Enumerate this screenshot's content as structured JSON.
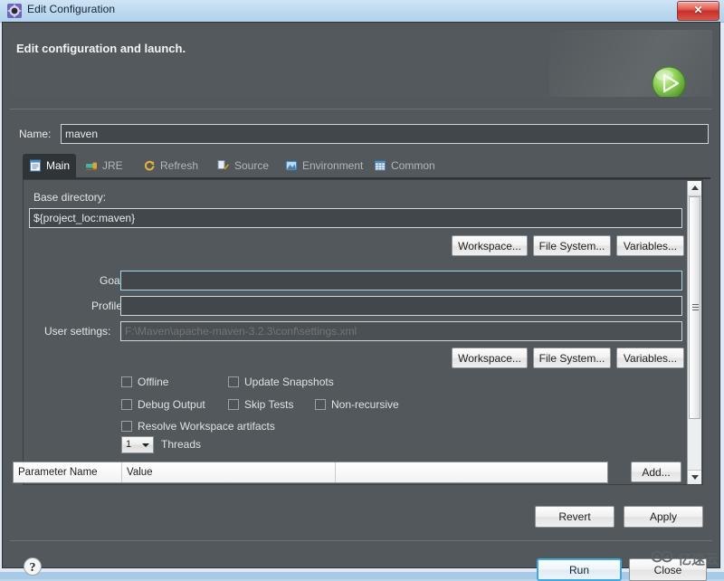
{
  "window": {
    "title": "Edit Configuration",
    "title_icon": "configuration-gear-icon",
    "close_glyph": "✕"
  },
  "header": {
    "title": "Edit configuration and launch.",
    "run_icon": "green-run-play-icon"
  },
  "name_field": {
    "label": "Name:",
    "value": "maven"
  },
  "tabs": [
    {
      "label": "Main",
      "icon": "document-icon",
      "active": true
    },
    {
      "label": "JRE",
      "icon": "jre-icon",
      "active": false
    },
    {
      "label": "Refresh",
      "icon": "refresh-icon",
      "active": false
    },
    {
      "label": "Source",
      "icon": "source-pencil-icon",
      "active": false
    },
    {
      "label": "Environment",
      "icon": "environment-icon",
      "active": false
    },
    {
      "label": "Common",
      "icon": "common-table-icon",
      "active": false
    }
  ],
  "main": {
    "base_directory": {
      "label": "Base directory:",
      "value": "${project_loc:maven}"
    },
    "dir_buttons": [
      {
        "label": "Workspace..."
      },
      {
        "label": "File System..."
      },
      {
        "label": "Variables..."
      }
    ],
    "goals": {
      "label": "Goals:",
      "value": ""
    },
    "profiles": {
      "label": "Profiles:",
      "value": ""
    },
    "user_settings": {
      "label": "User settings:",
      "value": "",
      "placeholder": "F:\\Maven\\apache-maven-3.2.3\\conf\\settings.xml"
    },
    "settings_buttons": [
      {
        "label": "Workspace..."
      },
      {
        "label": "File System..."
      },
      {
        "label": "Variables..."
      }
    ],
    "checkboxes": [
      {
        "label": "Offline",
        "checked": false
      },
      {
        "label": "Update Snapshots",
        "checked": false
      },
      {
        "label": "Debug Output",
        "checked": false
      },
      {
        "label": "Skip Tests",
        "checked": false
      },
      {
        "label": "Non-recursive",
        "checked": false
      },
      {
        "label": "Resolve Workspace artifacts",
        "checked": false
      }
    ],
    "threads": {
      "value": "1",
      "label": "Threads"
    },
    "parameter_table": {
      "columns": [
        "Parameter Name",
        "Value",
        ""
      ],
      "rows": []
    },
    "add_button": {
      "label": "Add..."
    }
  },
  "actions": {
    "revert": "Revert",
    "apply": "Apply",
    "run": "Run",
    "close": "Close",
    "help_icon": "help-question-icon"
  },
  "watermark": {
    "text": "亿速云"
  },
  "colors": {
    "dialog_bg": "#52585b",
    "panel_dark": "#2f3437",
    "field_bg": "#41474a",
    "accent_blue": "#3fa9e0",
    "run_green": "#72c440",
    "close_red": "#c62f27"
  }
}
